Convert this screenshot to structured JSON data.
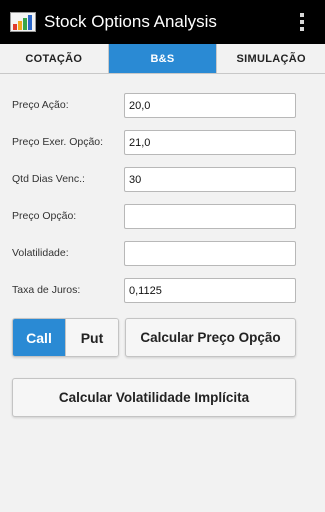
{
  "app": {
    "title": "Stock Options Analysis",
    "icon": "bar-chart-icon",
    "menu_icon": "overflow-menu-icon"
  },
  "tabs": [
    {
      "label": "COTAÇÃO",
      "active": false
    },
    {
      "label": "B&S",
      "active": true
    },
    {
      "label": "SIMULAÇÃO",
      "active": false
    }
  ],
  "form": {
    "stock_price": {
      "label": "Preço Ação:",
      "value": "20,0"
    },
    "strike_price": {
      "label": "Preço Exer. Opção:",
      "value": "21,0"
    },
    "days_to_expiry": {
      "label": "Qtd Dias Venc.:",
      "value": "30"
    },
    "option_price": {
      "label": "Preço Opção:",
      "value": ""
    },
    "volatility": {
      "label": "Volatilidade:",
      "value": ""
    },
    "interest_rate": {
      "label": "Taxa de Juros:",
      "value": "0,1125"
    }
  },
  "option_type": {
    "call_label": "Call",
    "put_label": "Put",
    "selected": "Call"
  },
  "actions": {
    "calc_price_label": "Calcular Preço Opção",
    "calc_volatility_label": "Calcular Volatilidade Implícita"
  },
  "colors": {
    "accent": "#2a8ad4",
    "actionbar": "#000000",
    "background": "#f2f2f2"
  }
}
